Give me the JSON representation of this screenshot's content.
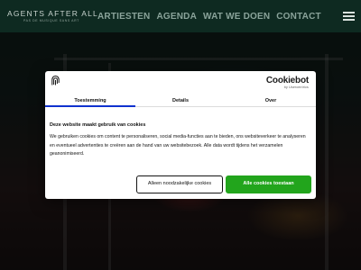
{
  "header": {
    "logo_title": "AGENTS AFTER ALL",
    "logo_subtitle": "PAS DE MUSIQUE SANS ART",
    "nav": [
      "ARTIESTEN",
      "AGENDA",
      "WAT WE DOEN",
      "CONTACT"
    ],
    "menu_icon": "hamburger-icon"
  },
  "dialog": {
    "icon": "fingerprint-icon",
    "brand": "Cookiebot",
    "brand_sub": "by Usercentrics",
    "tabs": [
      "Toestemming",
      "Details",
      "Over"
    ],
    "active_tab": "Toestemming",
    "heading": "Deze website maakt gebruik van cookies",
    "body": "We gebruiken cookies om content te personaliseren, social media-functies aan te bieden, ons websiteverkeer te analyseren en eventueel advertenties te creëren aan de hand van uw websitebezoek. Alle data wordt tijdens het verzamelen geanonimiseerd.",
    "btn_necessary": "Alleen noodzakelijke cookies",
    "btn_all": "Alle cookies toestaan"
  },
  "colors": {
    "header_bg": "#0e2a21",
    "accent_tab": "#1032cf",
    "accept_green": "#22a51c"
  }
}
